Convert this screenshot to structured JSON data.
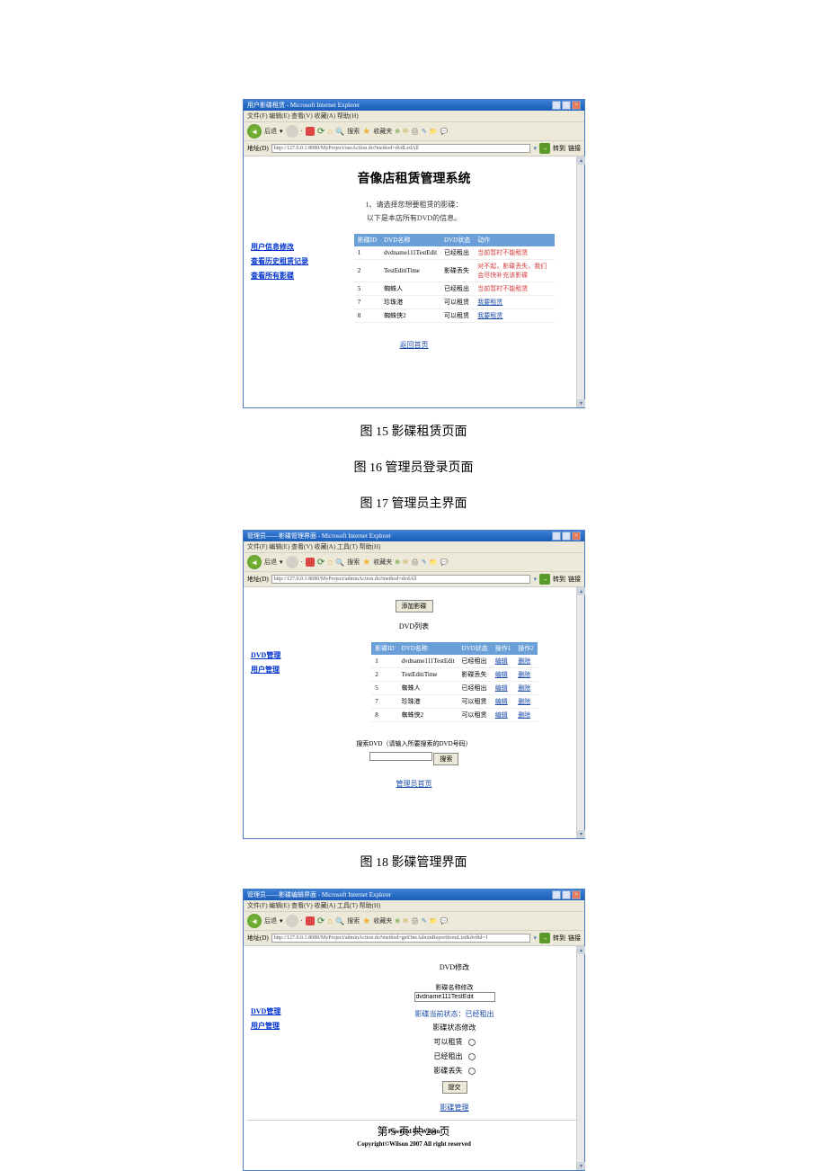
{
  "captions": {
    "fig15": "图 15  影碟租赁页面",
    "fig16": "图 16 管理员登录页面",
    "fig17": "图 17  管理员主界面",
    "fig18": "图 18  影碟管理界面"
  },
  "page_footer": "第 5 页 共 28 页",
  "window1": {
    "title": "用户影碟租赁 - Microsoft Internet Explorer",
    "menubar": "文件(F)  编辑(E)  查看(V)  收藏(A)  帮助(H)",
    "toolbar": {
      "back": "后退",
      "search": "搜索",
      "fav": "收藏夹"
    },
    "address_label": "地址(D)",
    "address_url": "http://127.0.0.1:8080/MyProject/useAction.do?method=dvdLedAll",
    "go": "转到",
    "links": "链接",
    "app_title": "音像店租赁管理系统",
    "subtitle1": "1、请选择您想要租赁的影碟：",
    "subtitle2": "以下是本店所有DVD的信息。",
    "sidebar": {
      "link1": "用户信息修改",
      "link2": "查看历史租赁记录",
      "link3": "查看所有影碟"
    },
    "headers": {
      "c1": "影碟ID",
      "c2": "DVD名称",
      "c3": "DVD状态",
      "c4": "动作"
    },
    "rows": [
      {
        "id": "1",
        "name": "dvdname111TestEdit",
        "status": "已经租出",
        "action": "当前暂时不能租赁",
        "red": true
      },
      {
        "id": "2",
        "name": "TestEditiTime",
        "status": "影碟丢失",
        "action": "对不起，影碟丢失，我们会尽快补充该影碟",
        "red": true
      },
      {
        "id": "5",
        "name": "蜘蛛人",
        "status": "已经租出",
        "action": "当前暂时不能租赁",
        "red": true
      },
      {
        "id": "7",
        "name": "珍珠港",
        "status": "可以租赁",
        "action": "我要租赁",
        "red": false
      },
      {
        "id": "8",
        "name": "蜘蛛侠2",
        "status": "可以租赁",
        "action": "我要租赁",
        "red": false
      }
    ],
    "return_link": "返回首页"
  },
  "window2": {
    "title": "管理员——影碟管理界面 - Microsoft Internet Explorer",
    "menubar": "文件(F)  编辑(E)  查看(V)  收藏(A)  工具(T)  帮助(H)",
    "address_url": "http://127.0.0.1:8080/MyProject/adminAction.do?method=dvdAll",
    "add_btn": "添加影碟",
    "list_title": "DVD列表",
    "sidebar": {
      "link1": "DVD管理",
      "link2": "用户管理"
    },
    "headers": {
      "c1": "影碟ID",
      "c2": "DVD名称",
      "c3": "DVD状态",
      "c4": "操作1",
      "c5": "操作2"
    },
    "rows": [
      {
        "id": "1",
        "name": "dvdname111TestEdit",
        "status": "已经租出",
        "op1": "编辑",
        "op2": "删除"
      },
      {
        "id": "2",
        "name": "TestEditiTime",
        "status": "影碟丢失",
        "op1": "编辑",
        "op2": "删除"
      },
      {
        "id": "5",
        "name": "蜘蛛人",
        "status": "已经租出",
        "op1": "编辑",
        "op2": "删除"
      },
      {
        "id": "7",
        "name": "珍珠港",
        "status": "可以租赁",
        "op1": "编辑",
        "op2": "删除"
      },
      {
        "id": "8",
        "name": "蜘蛛侠2",
        "status": "可以租赁",
        "op1": "编辑",
        "op2": "删除"
      }
    ],
    "search_label": "搜索DVD（请输入所要搜索的DVD号码）",
    "search_btn": "搜索",
    "return_link": "管理员首页"
  },
  "window3": {
    "title": "管理员——影碟编辑界面 - Microsoft Internet Explorer",
    "menubar": "文件(F)  编辑(E)  查看(V)  收藏(A)  工具(T)  帮助(H)",
    "address_url": "http://127.0.0.1:8080/MyProject/adminAction.do?method=getOneAdminReportfromList&dvdid=1",
    "page_title": "DVD修改",
    "name_label": "影碟名称修改",
    "name_value": "dvdname111TestEdit",
    "sidebar": {
      "link1": "DVD管理",
      "link2": "用户管理"
    },
    "current_status": "影碟当前状态：已经租出",
    "status_label": "影碟状态修改",
    "opt1": "可以租赁",
    "opt2": "已经租出",
    "opt3": "影碟丢失",
    "submit_btn": "提交",
    "back_link": "影碟管理",
    "powered": "Powered by Wilson",
    "copyright": "Copyright©Wilson 2007 All right reserved"
  }
}
